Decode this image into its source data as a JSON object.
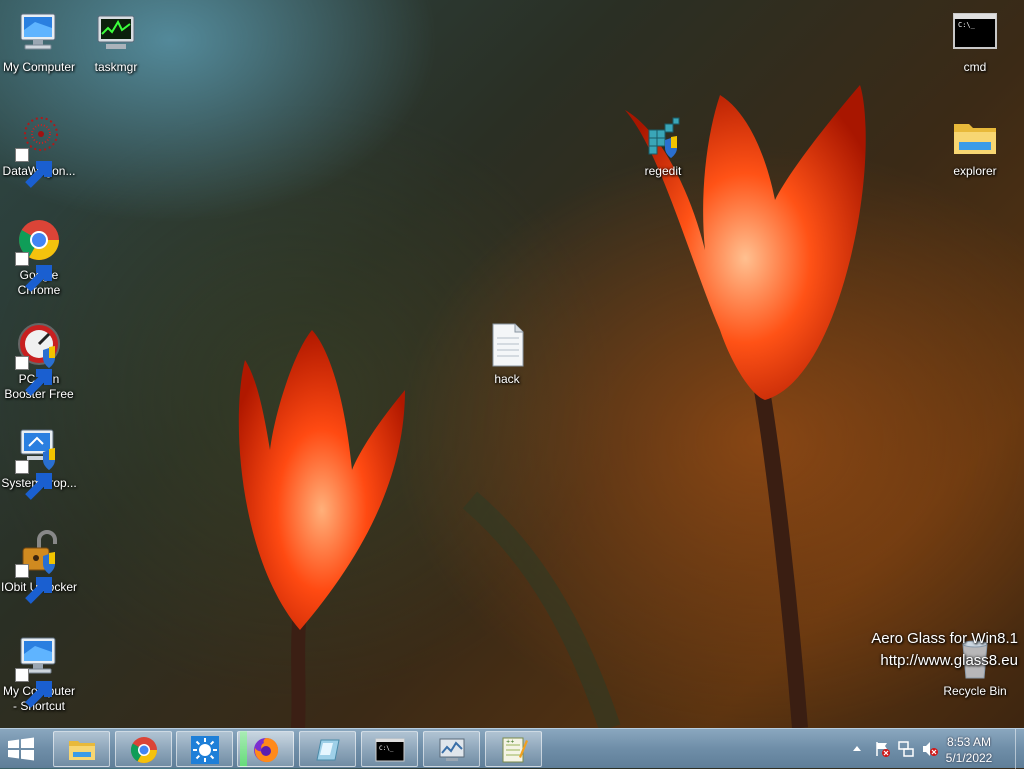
{
  "desktop": {
    "icons": [
      {
        "id": "my-computer",
        "label": "My Computer"
      },
      {
        "id": "taskmgr",
        "label": "taskmgr"
      },
      {
        "id": "cmd",
        "label": "cmd"
      },
      {
        "id": "datawagon",
        "label": "DataWagon..."
      },
      {
        "id": "regedit",
        "label": "regedit"
      },
      {
        "id": "explorer",
        "label": "explorer"
      },
      {
        "id": "chrome",
        "label": "Google Chrome"
      },
      {
        "id": "pcwin",
        "label": "PC Win Booster Free"
      },
      {
        "id": "hack",
        "label": "hack"
      },
      {
        "id": "sysprop",
        "label": "SystemProp..."
      },
      {
        "id": "iobit",
        "label": "IObit Unlocker"
      },
      {
        "id": "mycomp-shortcut",
        "label": "My Computer - Shortcut"
      },
      {
        "id": "recycle",
        "label": "Recycle Bin"
      }
    ],
    "watermark": {
      "line1": "Aero Glass for Win8.1",
      "line2": "http://www.glass8.eu"
    }
  },
  "taskbar": {
    "buttons": [
      "file-explorer",
      "google-chrome",
      "sun-app",
      "firefox",
      "glass-app",
      "command-prompt",
      "system-monitor",
      "notepad-plus-plus"
    ],
    "clock": {
      "time": "8:53 AM",
      "date": "5/1/2022"
    }
  },
  "colors": {
    "taskbar": "#6f8ea8",
    "flower": "#ff4a12"
  }
}
